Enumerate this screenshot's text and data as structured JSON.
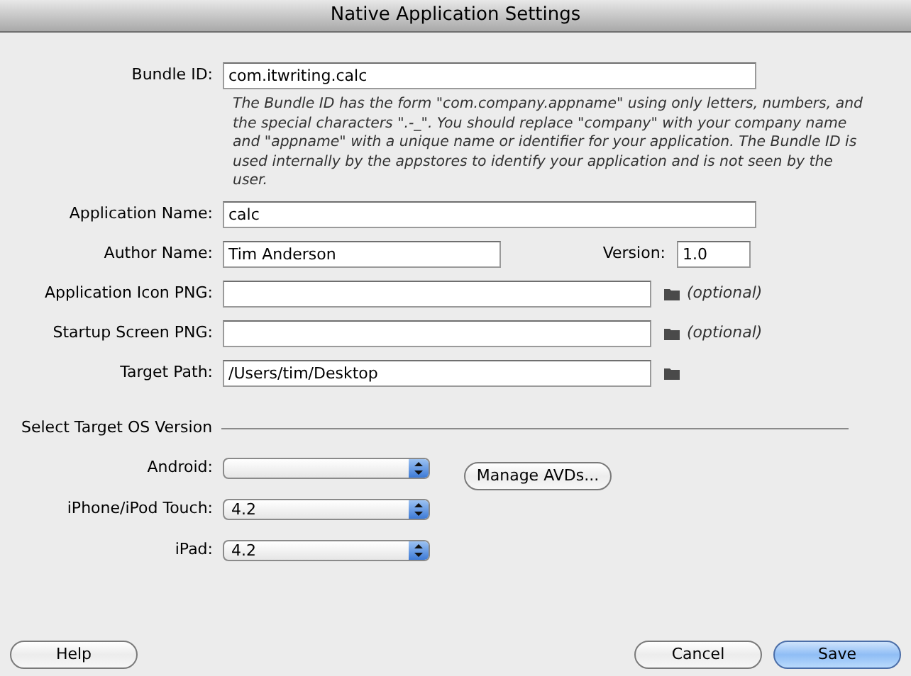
{
  "window": {
    "title": "Native Application Settings"
  },
  "bundle_id": {
    "label": "Bundle ID:",
    "value": "com.itwriting.calc"
  },
  "description": "The Bundle ID has the form \"com.company.appname\" using only letters, numbers, and the special characters \".-_\". You should replace \"company\" with your company name and \"appname\" with a unique name or identifier for your application. The Bundle ID is used internally by the appstores to identify your application and is not seen by the user.",
  "application_name": {
    "label": "Application Name:",
    "value": "calc"
  },
  "author_name": {
    "label": "Author Name:",
    "value": "Tim Anderson"
  },
  "version": {
    "label": "Version:",
    "value": "1.0"
  },
  "file_fields": [
    {
      "label": "Application Icon PNG:",
      "note": "(optional)"
    },
    {
      "label": "Startup Screen PNG:",
      "note": "(optional)"
    },
    {
      "label": "Target Path:",
      "value": "/Users/tim/Desktop"
    }
  ],
  "target_os": {
    "heading": "Select Target OS Version",
    "selects": [
      {
        "label": "Android:",
        "button": "Manage AVDs..."
      },
      {
        "label": "iPhone/iPod Touch:",
        "value": "4.2"
      },
      {
        "label": "iPad:",
        "value": "4.2"
      }
    ]
  },
  "left_buttons": [
    {
      "label": "Help",
      "default": false
    }
  ],
  "right_buttons": [
    {
      "label": "Cancel",
      "default": false
    },
    {
      "label": "Save",
      "default": true
    }
  ]
}
